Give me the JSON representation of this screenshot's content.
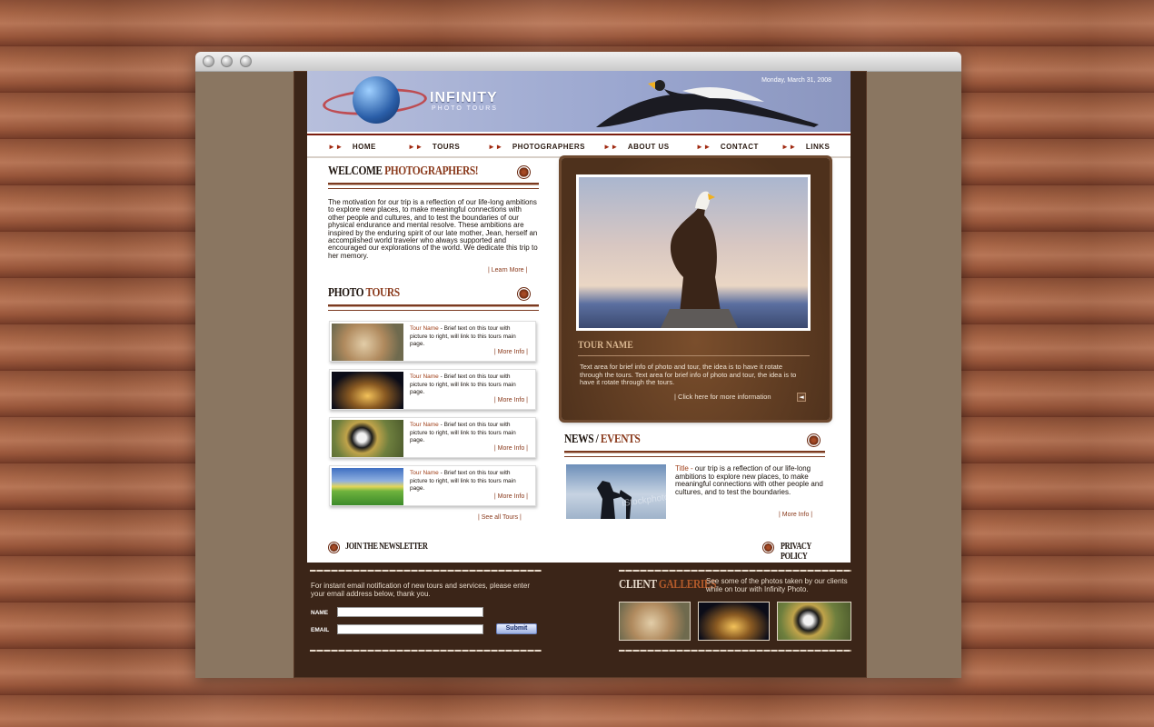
{
  "site": {
    "brand": "INFINITY",
    "brand_sub": "PHOTO TOURS",
    "date": "Monday, March 31, 2008"
  },
  "nav": {
    "items": [
      "HOME",
      "TOURS",
      "PHOTOGRAPHERS",
      "ABOUT US",
      "CONTACT",
      "LINKS"
    ]
  },
  "welcome": {
    "title_a": "WELCOME",
    "title_b": "PHOTOGRAPHERS!",
    "body": "The motivation for our trip is a reflection of our life-long ambitions to explore new places, to make meaningful connections with other people and cultures, and to test the boundaries of our physical endurance and mental resolve. These ambitions are inspired by the enduring spirit of our late mother, Jean, herself an accomplished world traveler who always supported and encouraged our explorations of the world. We dedicate this trip to her memory.",
    "link": "| Learn More |"
  },
  "photo_tours": {
    "title_a": "PHOTO",
    "title_b": "TOURS",
    "items": [
      {
        "name": "Tour Name",
        "text": " - Brief text on this tour with picture to right, will link to this tours main page.",
        "link": "| More Info |"
      },
      {
        "name": "Tour Name",
        "text": " - Brief text on this tour with picture to right, will link to this tours main page.",
        "link": "| More Info |"
      },
      {
        "name": "Tour Name",
        "text": " - Brief text on this tour with picture to right, will link to this tours main page.",
        "link": "| More Info |"
      },
      {
        "name": "Tour Name",
        "text": " - Brief text on this tour with picture to right, will link to this tours main page.",
        "link": "| More Info |"
      }
    ],
    "see_all": "| See all Tours |"
  },
  "featured": {
    "title": "TOUR NAME",
    "text": "Text area for brief info of photo and tour, the idea is to have it rotate through the tours.  Text area for brief info of photo and tour, the idea is to have it rotate through the tours.",
    "link": "| Click here for more information"
  },
  "news": {
    "title_a": "NEWS /",
    "title_b": "EVENTS",
    "item_title": "Title -",
    "item_text": " our trip is a reflection of our life-long ambitions to explore new places, to make meaningful connections with other people and cultures, and to test the boundaries.",
    "link": "| More Info |",
    "watermark": "iStockphoto"
  },
  "footer_links": {
    "newsletter": "JOIN THE NEWSLETTER",
    "privacy": "PRIVACY POLICY"
  },
  "newsletter": {
    "intro": "For instant email notification of new tours and services, please enter your email address below, thank you.",
    "name_label": "NAME",
    "email_label": "EMAIL",
    "name_value": "",
    "email_value": "",
    "submit": "Submit"
  },
  "galleries": {
    "title_a": "CLIENT",
    "title_b": "GALLERIES",
    "text": "See some of the photos taken by our clients while on tour with Infinity Photo."
  },
  "colors": {
    "accent": "#8a3a1c",
    "site_bg": "#3b2518",
    "header": "#9aa6cf"
  }
}
